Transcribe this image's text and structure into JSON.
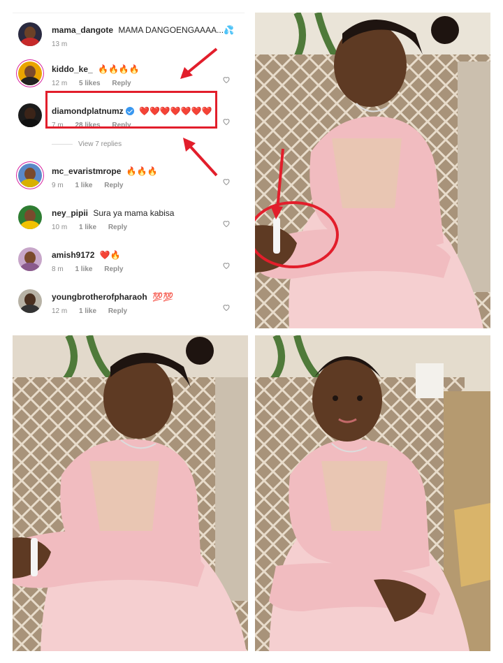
{
  "comments": [
    {
      "username": "mama_dangote",
      "message": "MAMA DANGOENGAAAA...💦",
      "time": "13 m",
      "likes": "",
      "reply": "",
      "avatar": "avatar-mama-dangote"
    },
    {
      "username": "kiddo_ke_",
      "message": "🔥🔥🔥🔥",
      "time": "12 m",
      "likes": "5 likes",
      "reply": "Reply",
      "avatar": "avatar-kiddo"
    },
    {
      "username": "diamondplatnumz",
      "message": "❤️❤️❤️❤️❤️❤️❤️",
      "time": "7 m",
      "likes": "28 likes",
      "reply": "Reply",
      "avatar": "avatar-diamond",
      "verified": true
    },
    {
      "username": "mc_evaristmrope",
      "message": "🔥🔥🔥",
      "time": "9 m",
      "likes": "1 like",
      "reply": "Reply",
      "avatar": "avatar-mc"
    },
    {
      "username": "ney_pipii",
      "message": "Sura  ya mama kabisa",
      "time": "10 m",
      "likes": "1 like",
      "reply": "Reply",
      "avatar": "avatar-ney"
    },
    {
      "username": "amish9172",
      "message": "❤️🔥",
      "time": "8 m",
      "likes": "1 like",
      "reply": "Reply",
      "avatar": "avatar-amish"
    },
    {
      "username": "youngbrotherofpharaoh",
      "message": "💯💯",
      "time": "12 m",
      "likes": "1 like",
      "reply": "Reply",
      "avatar": "avatar-young"
    }
  ],
  "view_replies": "View 7 replies",
  "colors": {
    "highlight": "#e21e2b",
    "meta": "#8e8e8e",
    "verified": "#3897f0",
    "sweater": "#f1bcc0",
    "chair": "#b29d80"
  },
  "icons": [
    "heart-icon",
    "verified-badge-icon",
    "arrow-icon"
  ]
}
